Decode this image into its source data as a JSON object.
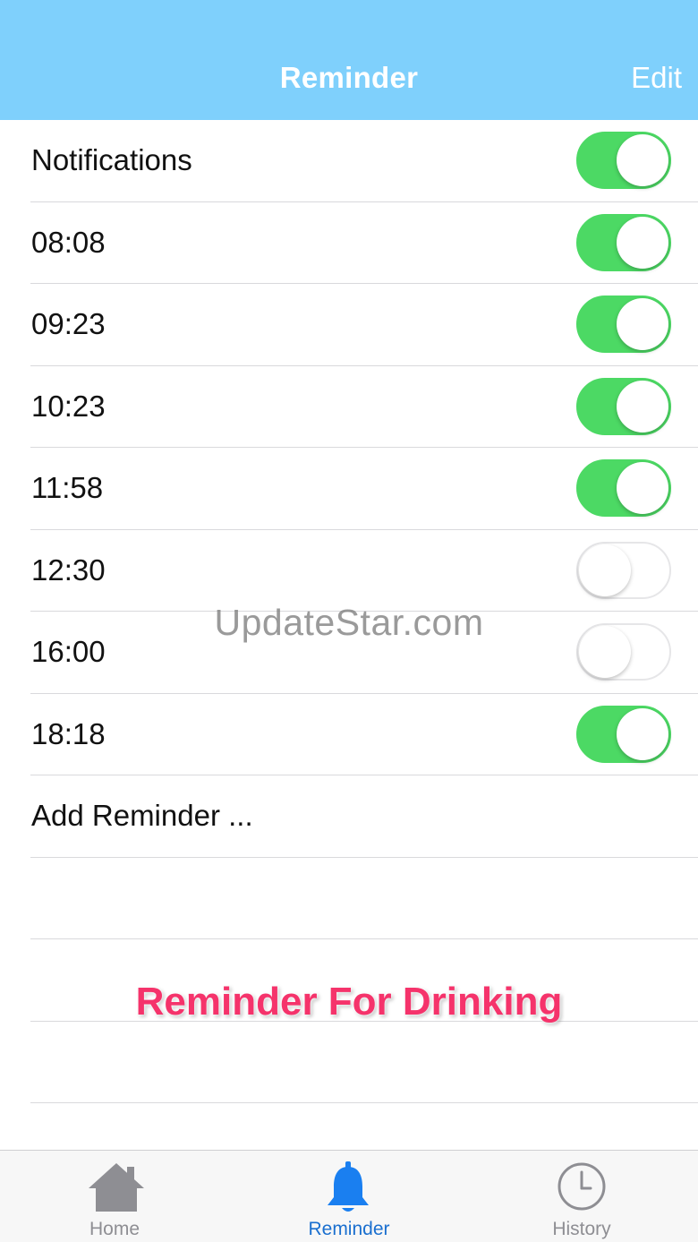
{
  "header": {
    "title": "Reminder",
    "edit_label": "Edit"
  },
  "rows": [
    {
      "label": "Notifications",
      "on": true
    },
    {
      "label": "08:08",
      "on": true
    },
    {
      "label": "09:23",
      "on": true
    },
    {
      "label": "10:23",
      "on": true
    },
    {
      "label": "11:58",
      "on": true
    },
    {
      "label": "12:30",
      "on": false
    },
    {
      "label": "16:00",
      "on": false
    },
    {
      "label": "18:18",
      "on": true
    }
  ],
  "add_reminder_label": "Add Reminder ...",
  "watermark": "UpdateStar.com",
  "caption": "Reminder For Drinking",
  "tabbar": {
    "tabs": [
      {
        "label": "Home",
        "icon": "home-icon",
        "active": false
      },
      {
        "label": "Reminder",
        "icon": "bell-icon",
        "active": true
      },
      {
        "label": "History",
        "icon": "clock-icon",
        "active": false
      }
    ]
  },
  "colors": {
    "nav_background": "#7fd0fc",
    "toggle_on": "#4cd964",
    "tab_active": "#1a6fcf",
    "tab_inactive": "#8e8e93",
    "caption": "#f5336b"
  }
}
